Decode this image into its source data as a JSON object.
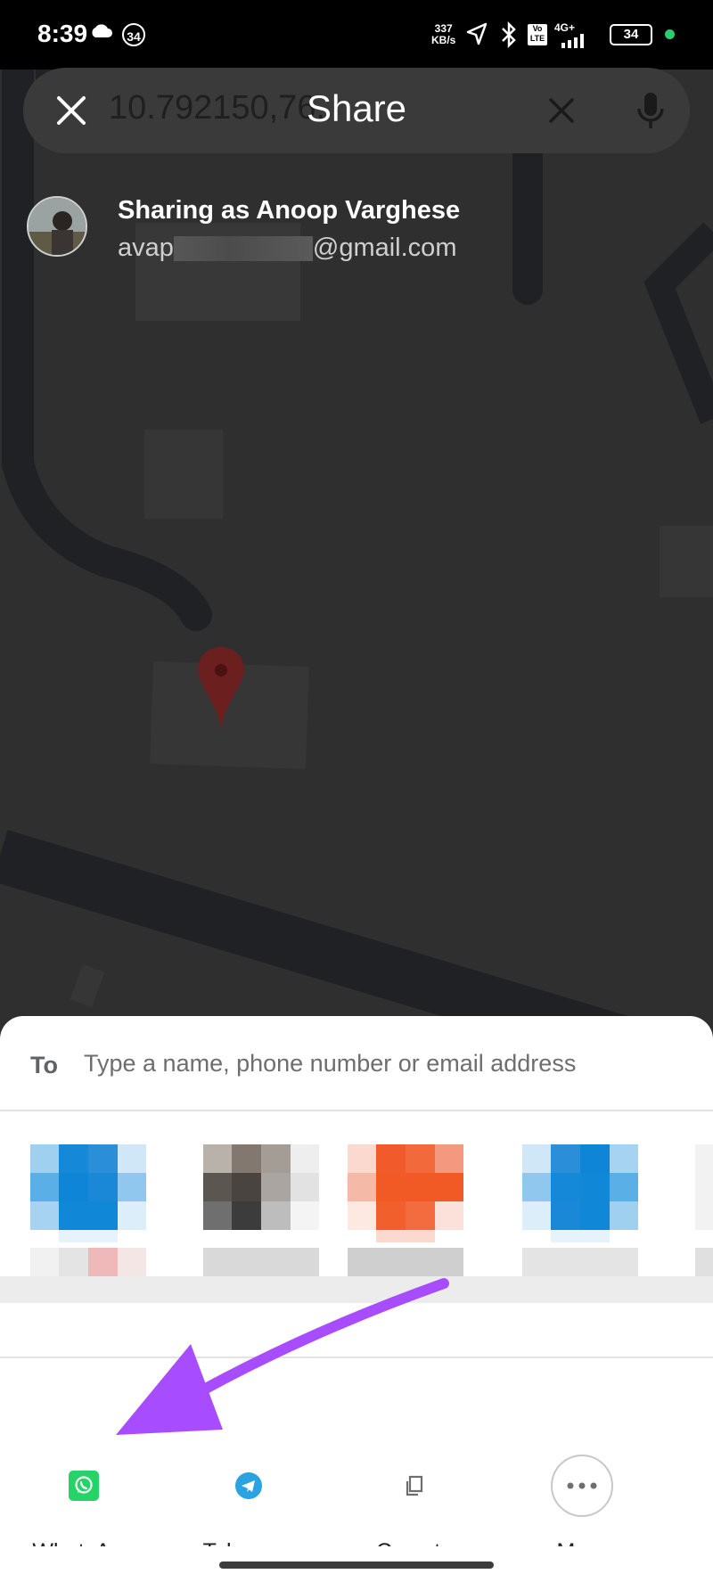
{
  "status_bar": {
    "time": "8:39",
    "notification_count": "34",
    "network_speed_value": "337",
    "network_speed_unit": "KB/s",
    "network_type": "4G+",
    "volte": "Vo LTE",
    "battery": "34"
  },
  "top_bar": {
    "search_coordinates": "10.792150,76.",
    "title": "Share"
  },
  "sharing": {
    "label": "Sharing as Anoop Varghese",
    "email_prefix": "avap",
    "email_suffix": "@gmail.com"
  },
  "share_sheet": {
    "to_label": "To",
    "to_placeholder": "Type a name, phone number or email address",
    "apps": [
      {
        "label": "WhatsApp",
        "icon": "whatsapp-icon",
        "color": "#25d366"
      },
      {
        "label": "Telegram",
        "icon": "telegram-icon",
        "color": "#2aa3e0"
      },
      {
        "label": "Copy to clipboard",
        "icon": "copy-icon",
        "color": "#6e6e6e"
      },
      {
        "label": "More",
        "icon": "more-icon",
        "color": "#6e6e6e"
      }
    ]
  },
  "colors": {
    "annotation_arrow": "#a74dff",
    "map_pin": "#6b1f1f"
  }
}
